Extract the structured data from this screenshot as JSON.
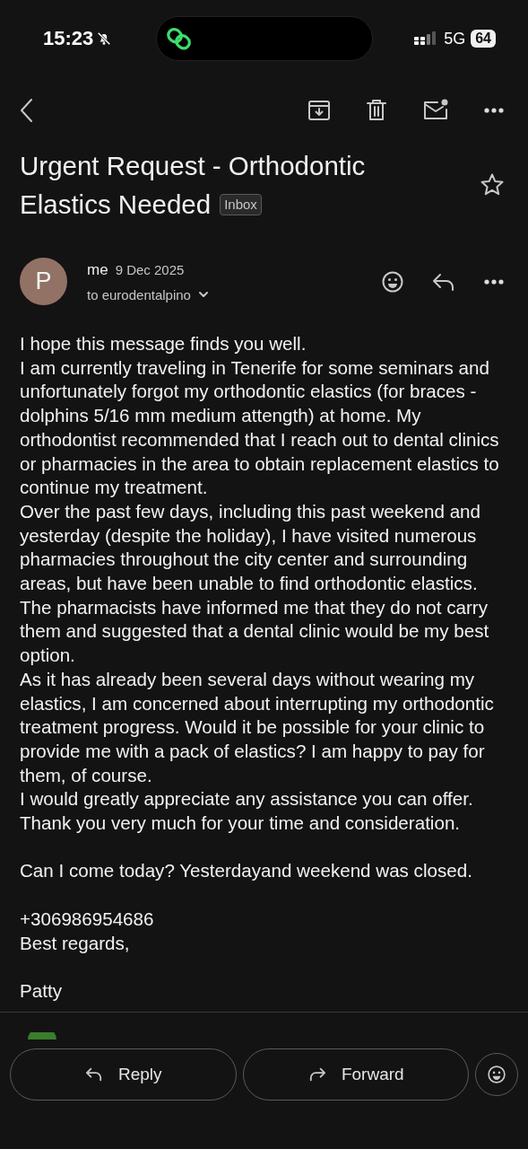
{
  "status_bar": {
    "time": "15:23",
    "network": "5G",
    "battery": "64"
  },
  "subject": {
    "title_lines": [
      "Urgent Request - Orthodontic",
      "Elastics Needed"
    ],
    "label": "Inbox",
    "starred": false
  },
  "message": {
    "avatar_letter": "P",
    "sender": "me",
    "date": "9 Dec 2025",
    "recipient": "to eurodentalpino",
    "body": [
      [
        "I hope this message finds you well.",
        "I am currently traveling in Tenerife for some seminars and unfortunately forgot my orthodontic elastics (for braces - dolphins 5/16 mm medium attength) at home. My orthodontist recommended that I reach out to dental clinics or pharmacies in the area to obtain replacement elastics to continue my treatment.",
        "Over the past few days, including this past weekend and yesterday (despite the holiday), I have visited numerous pharmacies throughout the city center and surrounding areas, but have been unable to find orthodontic elastics. The pharmacists have informed me that they do not carry them and suggested that a dental clinic would be my best option.",
        "As it has already been several days without wearing my elastics, I am concerned about interrupting my orthodontic treatment progress. Would it be possible for your clinic to provide me with a pack of elastics? I am happy to pay for them, of course.",
        "I would greatly appreciate any assistance you can offer.",
        "Thank you very much for your time and consideration."
      ],
      [
        "Can I come today? Yesterdayand weekend was closed."
      ],
      [
        "+306986954686",
        "Best regards,"
      ],
      [
        "Patty"
      ]
    ]
  },
  "actions": [
    {
      "kind": "reply",
      "label": "Reply"
    },
    {
      "kind": "forward",
      "label": "Forward"
    },
    {
      "kind": "emoji"
    }
  ]
}
